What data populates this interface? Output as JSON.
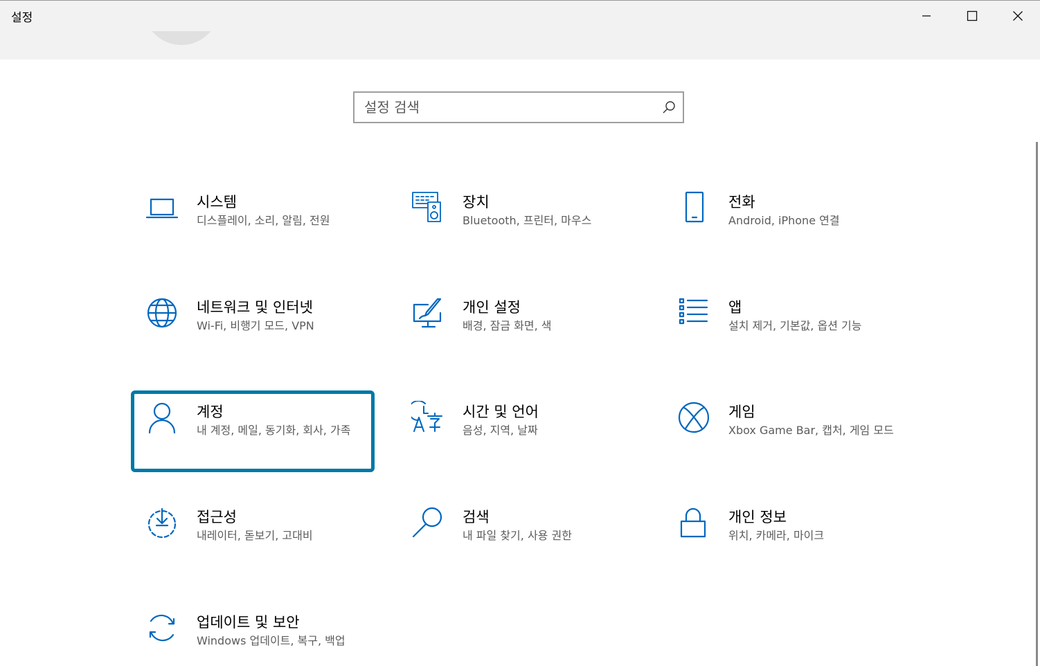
{
  "window": {
    "title": "설정",
    "controls": {
      "minimize": "minimize",
      "maximize": "maximize",
      "close": "close"
    }
  },
  "search": {
    "placeholder": "설정 검색",
    "value": ""
  },
  "tiles": [
    {
      "title": "시스템",
      "desc": "디스플레이, 소리, 알림, 전원",
      "icon": "laptop-icon"
    },
    {
      "title": "장치",
      "desc": "Bluetooth, 프린터, 마우스",
      "icon": "devices-icon"
    },
    {
      "title": "전화",
      "desc": "Android, iPhone 연결",
      "icon": "phone-icon"
    },
    {
      "title": "네트워크 및 인터넷",
      "desc": "Wi-Fi, 비행기 모드, VPN",
      "icon": "globe-icon"
    },
    {
      "title": "개인 설정",
      "desc": "배경, 잠금 화면, 색",
      "icon": "personalization-icon"
    },
    {
      "title": "앱",
      "desc": "설치 제거, 기본값, 옵션 기능",
      "icon": "apps-list-icon"
    },
    {
      "title": "계정",
      "desc": "내 계정, 메일, 동기화, 회사, 가족",
      "icon": "person-icon",
      "focused": true
    },
    {
      "title": "시간 및 언어",
      "desc": "음성, 지역, 날짜",
      "icon": "time-language-icon"
    },
    {
      "title": "게임",
      "desc": "Xbox Game Bar, 캡처, 게임 모드",
      "icon": "xbox-icon"
    },
    {
      "title": "접근성",
      "desc": "내레이터, 돋보기, 고대비",
      "icon": "accessibility-icon"
    },
    {
      "title": "검색",
      "desc": "내 파일 찾기, 사용 권한",
      "icon": "search-icon"
    },
    {
      "title": "개인 정보",
      "desc": "위치, 카메라, 마이크",
      "icon": "lock-icon"
    },
    {
      "title": "업데이트 및 보안",
      "desc": "Windows 업데이트, 복구, 백업",
      "icon": "sync-icon"
    }
  ],
  "colors": {
    "accent": "#0067c0",
    "focus": "#0078a8",
    "titlebar": "#f2f2f2",
    "desc": "#5c5c5c"
  }
}
